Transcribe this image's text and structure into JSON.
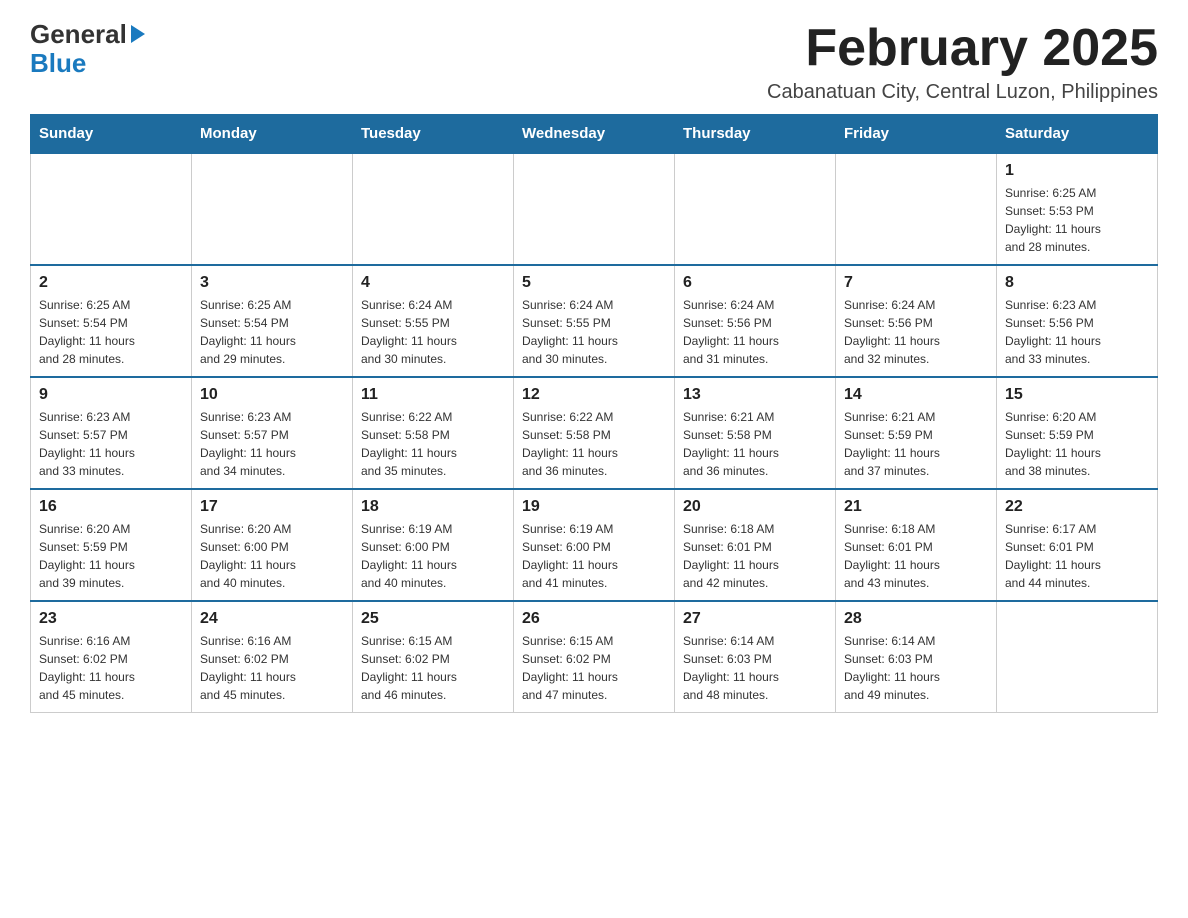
{
  "header": {
    "logo_general": "General",
    "logo_blue": "Blue",
    "main_title": "February 2025",
    "subtitle": "Cabanatuan City, Central Luzon, Philippines"
  },
  "calendar": {
    "days_of_week": [
      "Sunday",
      "Monday",
      "Tuesday",
      "Wednesday",
      "Thursday",
      "Friday",
      "Saturday"
    ],
    "weeks": [
      [
        {
          "day": "",
          "info": ""
        },
        {
          "day": "",
          "info": ""
        },
        {
          "day": "",
          "info": ""
        },
        {
          "day": "",
          "info": ""
        },
        {
          "day": "",
          "info": ""
        },
        {
          "day": "",
          "info": ""
        },
        {
          "day": "1",
          "info": "Sunrise: 6:25 AM\nSunset: 5:53 PM\nDaylight: 11 hours\nand 28 minutes."
        }
      ],
      [
        {
          "day": "2",
          "info": "Sunrise: 6:25 AM\nSunset: 5:54 PM\nDaylight: 11 hours\nand 28 minutes."
        },
        {
          "day": "3",
          "info": "Sunrise: 6:25 AM\nSunset: 5:54 PM\nDaylight: 11 hours\nand 29 minutes."
        },
        {
          "day": "4",
          "info": "Sunrise: 6:24 AM\nSunset: 5:55 PM\nDaylight: 11 hours\nand 30 minutes."
        },
        {
          "day": "5",
          "info": "Sunrise: 6:24 AM\nSunset: 5:55 PM\nDaylight: 11 hours\nand 30 minutes."
        },
        {
          "day": "6",
          "info": "Sunrise: 6:24 AM\nSunset: 5:56 PM\nDaylight: 11 hours\nand 31 minutes."
        },
        {
          "day": "7",
          "info": "Sunrise: 6:24 AM\nSunset: 5:56 PM\nDaylight: 11 hours\nand 32 minutes."
        },
        {
          "day": "8",
          "info": "Sunrise: 6:23 AM\nSunset: 5:56 PM\nDaylight: 11 hours\nand 33 minutes."
        }
      ],
      [
        {
          "day": "9",
          "info": "Sunrise: 6:23 AM\nSunset: 5:57 PM\nDaylight: 11 hours\nand 33 minutes."
        },
        {
          "day": "10",
          "info": "Sunrise: 6:23 AM\nSunset: 5:57 PM\nDaylight: 11 hours\nand 34 minutes."
        },
        {
          "day": "11",
          "info": "Sunrise: 6:22 AM\nSunset: 5:58 PM\nDaylight: 11 hours\nand 35 minutes."
        },
        {
          "day": "12",
          "info": "Sunrise: 6:22 AM\nSunset: 5:58 PM\nDaylight: 11 hours\nand 36 minutes."
        },
        {
          "day": "13",
          "info": "Sunrise: 6:21 AM\nSunset: 5:58 PM\nDaylight: 11 hours\nand 36 minutes."
        },
        {
          "day": "14",
          "info": "Sunrise: 6:21 AM\nSunset: 5:59 PM\nDaylight: 11 hours\nand 37 minutes."
        },
        {
          "day": "15",
          "info": "Sunrise: 6:20 AM\nSunset: 5:59 PM\nDaylight: 11 hours\nand 38 minutes."
        }
      ],
      [
        {
          "day": "16",
          "info": "Sunrise: 6:20 AM\nSunset: 5:59 PM\nDaylight: 11 hours\nand 39 minutes."
        },
        {
          "day": "17",
          "info": "Sunrise: 6:20 AM\nSunset: 6:00 PM\nDaylight: 11 hours\nand 40 minutes."
        },
        {
          "day": "18",
          "info": "Sunrise: 6:19 AM\nSunset: 6:00 PM\nDaylight: 11 hours\nand 40 minutes."
        },
        {
          "day": "19",
          "info": "Sunrise: 6:19 AM\nSunset: 6:00 PM\nDaylight: 11 hours\nand 41 minutes."
        },
        {
          "day": "20",
          "info": "Sunrise: 6:18 AM\nSunset: 6:01 PM\nDaylight: 11 hours\nand 42 minutes."
        },
        {
          "day": "21",
          "info": "Sunrise: 6:18 AM\nSunset: 6:01 PM\nDaylight: 11 hours\nand 43 minutes."
        },
        {
          "day": "22",
          "info": "Sunrise: 6:17 AM\nSunset: 6:01 PM\nDaylight: 11 hours\nand 44 minutes."
        }
      ],
      [
        {
          "day": "23",
          "info": "Sunrise: 6:16 AM\nSunset: 6:02 PM\nDaylight: 11 hours\nand 45 minutes."
        },
        {
          "day": "24",
          "info": "Sunrise: 6:16 AM\nSunset: 6:02 PM\nDaylight: 11 hours\nand 45 minutes."
        },
        {
          "day": "25",
          "info": "Sunrise: 6:15 AM\nSunset: 6:02 PM\nDaylight: 11 hours\nand 46 minutes."
        },
        {
          "day": "26",
          "info": "Sunrise: 6:15 AM\nSunset: 6:02 PM\nDaylight: 11 hours\nand 47 minutes."
        },
        {
          "day": "27",
          "info": "Sunrise: 6:14 AM\nSunset: 6:03 PM\nDaylight: 11 hours\nand 48 minutes."
        },
        {
          "day": "28",
          "info": "Sunrise: 6:14 AM\nSunset: 6:03 PM\nDaylight: 11 hours\nand 49 minutes."
        },
        {
          "day": "",
          "info": ""
        }
      ]
    ]
  }
}
